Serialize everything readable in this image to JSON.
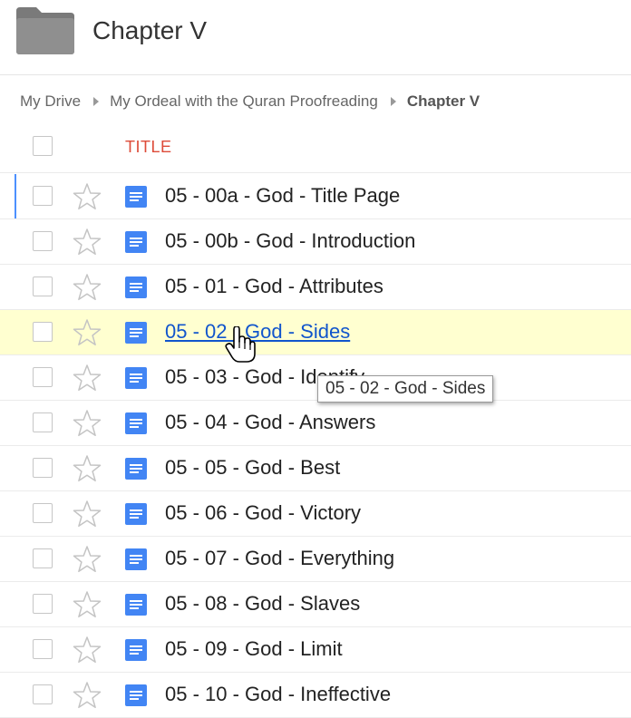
{
  "folder": {
    "title": "Chapter V",
    "icon": "folder-icon"
  },
  "breadcrumb": [
    "My Drive",
    "My Ordeal with the Quran Proofreading",
    "Chapter V"
  ],
  "list_header": {
    "title_label": "TITLE"
  },
  "colors": {
    "accent_red": "#dd4b39",
    "doc_blue": "#4285f4",
    "link_blue": "#1155cc",
    "hover_row": "#ffffd0",
    "selection_bar": "#4d90fe"
  },
  "files": [
    {
      "name": "05 - 00a - God - Title Page",
      "icon": "doc-icon",
      "selected": true
    },
    {
      "name": "05 - 00b - God - Introduction",
      "icon": "doc-icon"
    },
    {
      "name": "05 - 01 - God - Attributes",
      "icon": "doc-icon"
    },
    {
      "name": "05 - 02 - God - Sides",
      "icon": "doc-icon",
      "hovered": true
    },
    {
      "name": "05 - 03 - God - Identify",
      "icon": "doc-icon"
    },
    {
      "name": "05 - 04 - God - Answers",
      "icon": "doc-icon"
    },
    {
      "name": "05 - 05 - God - Best",
      "icon": "doc-icon"
    },
    {
      "name": "05 - 06 - God - Victory",
      "icon": "doc-icon"
    },
    {
      "name": "05 - 07 - God - Everything",
      "icon": "doc-icon"
    },
    {
      "name": "05 - 08 - God - Slaves",
      "icon": "doc-icon"
    },
    {
      "name": "05 - 09 - God - Limit",
      "icon": "doc-icon"
    },
    {
      "name": "05 - 10 - God - Ineffective",
      "icon": "doc-icon"
    }
  ],
  "tooltip": {
    "text": "05 - 02 - God - Sides"
  }
}
